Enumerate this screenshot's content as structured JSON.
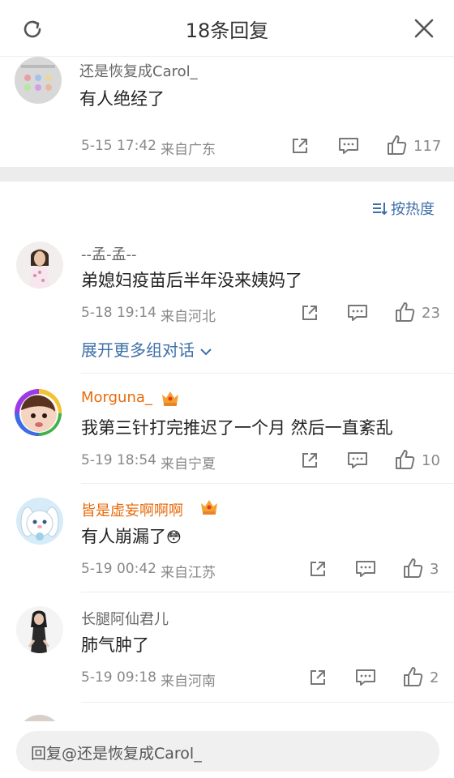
{
  "header": {
    "title": "18条回复"
  },
  "sort": {
    "label": "按热度"
  },
  "original": {
    "name": "还是恢复成Carol_",
    "text": "有人绝经了",
    "time": "5-15 17:42",
    "location": "来自广东",
    "likes": "117"
  },
  "replies": [
    {
      "name": "--孟-孟--",
      "text": "弟媳妇疫苗后半年没来姨妈了",
      "time": "5-18 19:14",
      "location": "来自河北",
      "likes": "23",
      "more": "展开更多组对话"
    },
    {
      "name": "Morguna_",
      "text": "我第三针打完推迟了一个月 然后一直紊乱",
      "time": "5-19 18:54",
      "location": "来自宁夏",
      "likes": "10"
    },
    {
      "name": "皆是虚妄啊啊啊",
      "text": "有人崩漏了",
      "emoji": "😳",
      "time": "5-19 00:42",
      "location": "来自江苏",
      "likes": "3"
    },
    {
      "name": "长腿阿仙君儿",
      "text": "肺气肿了",
      "time": "5-19 09:18",
      "location": "来自河南",
      "likes": "2"
    }
  ],
  "reply_bar": {
    "placeholder": "回复@还是恢复成Carol_"
  },
  "colors": {
    "link": "#3d6fa8",
    "vip_name": "#e86b0c",
    "meta": "#888888"
  }
}
